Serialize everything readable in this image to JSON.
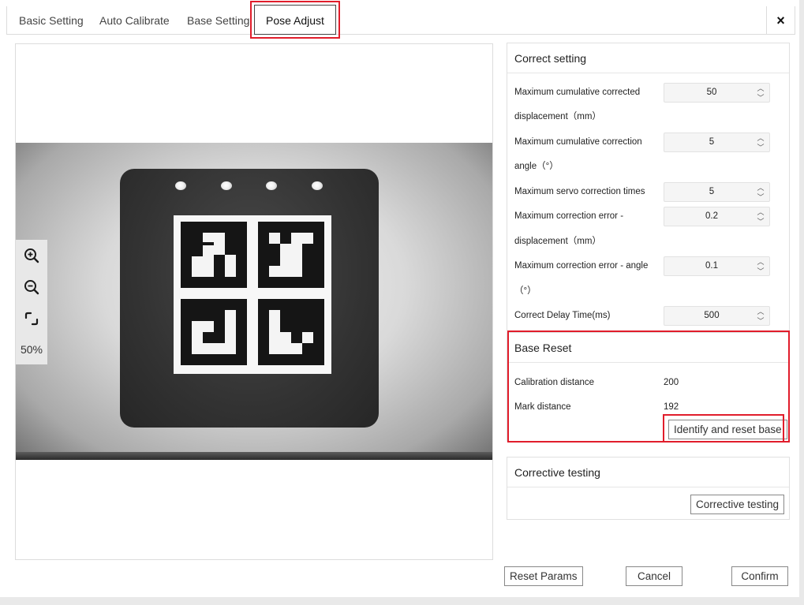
{
  "tabs": [
    {
      "label": "Basic Setting"
    },
    {
      "label": "Auto Calibrate"
    },
    {
      "label": "Base Setting"
    },
    {
      "label": "Pose Adjust",
      "active": true
    }
  ],
  "close_label": "×",
  "viewer": {
    "zoom_level": "50%",
    "tools": [
      "zoom-in-icon",
      "zoom-out-icon",
      "fit-screen-icon"
    ]
  },
  "correct_setting": {
    "title": "Correct setting",
    "fields": [
      {
        "label_line1": "Maximum cumulative corrected",
        "label_line2": "displacement（mm）",
        "value": "50"
      },
      {
        "label_line1": "Maximum cumulative correction",
        "label_line2": "angle（°）",
        "value": "5"
      },
      {
        "label_line1": "Maximum servo correction times",
        "label_line2": "",
        "value": "5"
      },
      {
        "label_line1": "Maximum correction error -",
        "label_line2": "displacement（mm）",
        "value": "0.2"
      },
      {
        "label_line1": "Maximum correction error - angle",
        "label_line2": "（°）",
        "value": "0.1"
      },
      {
        "label_line1": "Correct Delay Time(ms)",
        "label_line2": "",
        "value": "500"
      }
    ]
  },
  "base_reset": {
    "title": "Base Reset",
    "calibration_distance_label": "Calibration distance",
    "calibration_distance_value": "200",
    "mark_distance_label": "Mark distance",
    "mark_distance_value": "192",
    "identify_button": "Identify and reset base"
  },
  "corrective_testing": {
    "title": "Corrective testing",
    "button": "Corrective testing"
  },
  "footer": {
    "reset_params": "Reset Params",
    "cancel": "Cancel",
    "confirm": "Confirm"
  },
  "colors": {
    "highlight": "#e11d2b",
    "border": "#dcdcdc"
  }
}
